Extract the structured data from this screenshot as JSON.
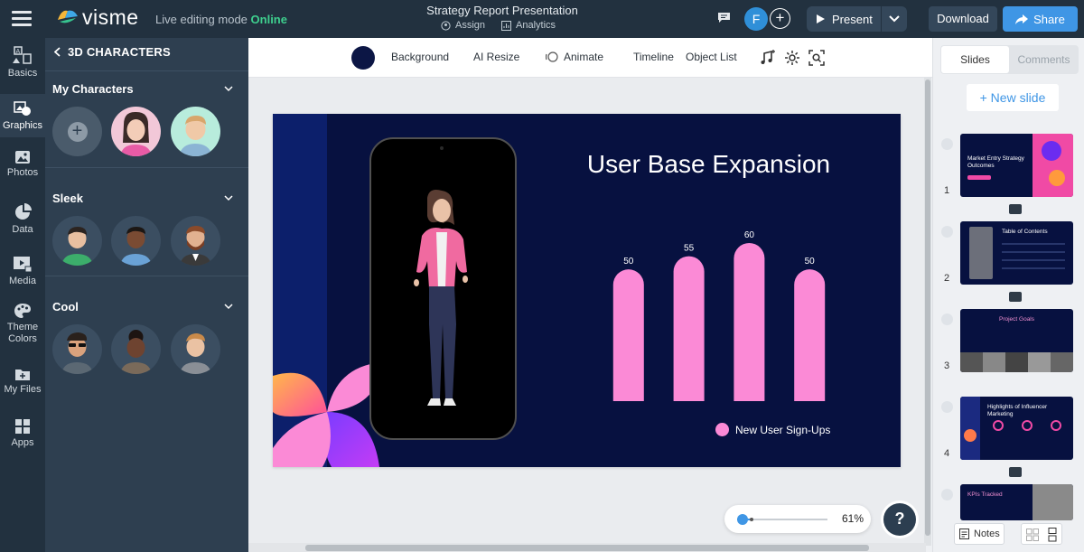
{
  "app": {
    "brand": "visme",
    "mode_label": "Live editing mode",
    "mode_status": "Online",
    "doc_title": "Strategy Report Presentation",
    "assign_label": "Assign",
    "analytics_label": "Analytics",
    "avatar_initial": "F",
    "present_label": "Present",
    "download_label": "Download",
    "share_label": "Share"
  },
  "rail": [
    {
      "label": "Basics",
      "icon": "basics-icon"
    },
    {
      "label": "Graphics",
      "icon": "graphics-icon"
    },
    {
      "label": "Photos",
      "icon": "photos-icon"
    },
    {
      "label": "Data",
      "icon": "data-icon"
    },
    {
      "label": "Media",
      "icon": "media-icon"
    },
    {
      "label": "Theme Colors",
      "icon": "palette-icon"
    },
    {
      "label": "My Files",
      "icon": "folder-icon"
    },
    {
      "label": "Apps",
      "icon": "apps-icon"
    }
  ],
  "panel": {
    "heading": "3D CHARACTERS",
    "sections": [
      {
        "title": "My Characters"
      },
      {
        "title": "Sleek"
      },
      {
        "title": "Cool"
      }
    ]
  },
  "toolbar": {
    "background": "Background",
    "ai_resize": "AI Resize",
    "animate": "Animate",
    "timeline": "Timeline",
    "object_list": "Object List",
    "bg_color": "#0c1645"
  },
  "slide": {
    "title": "User Base Expansion",
    "legend": "New User Sign-Ups"
  },
  "chart_data": {
    "type": "bar",
    "categories": [
      "",
      "",
      "",
      ""
    ],
    "series": [
      {
        "name": "New User Sign-Ups",
        "values": [
          50,
          55,
          60,
          50
        ]
      }
    ],
    "title": "User Base Expansion",
    "xlabel": "",
    "ylabel": "",
    "ylim": [
      0,
      60
    ],
    "grid": false,
    "legend": "bottom-right",
    "bar_color": "#fb8ad6"
  },
  "zoom": {
    "value": "61%",
    "fraction": 0.61
  },
  "help_label": "?",
  "right": {
    "tab_slides": "Slides",
    "tab_comments": "Comments",
    "new_slide": "+ New slide",
    "notes": "Notes",
    "thumbs": [
      {
        "num": "1",
        "text": "Market Entry Strategy Outcomes"
      },
      {
        "num": "2",
        "text": "Table of Contents"
      },
      {
        "num": "3",
        "text": "Project Goals"
      },
      {
        "num": "4",
        "text": "Highlights of Influencer Marketing"
      },
      {
        "num": "",
        "text": "KPIs Tracked"
      }
    ]
  }
}
